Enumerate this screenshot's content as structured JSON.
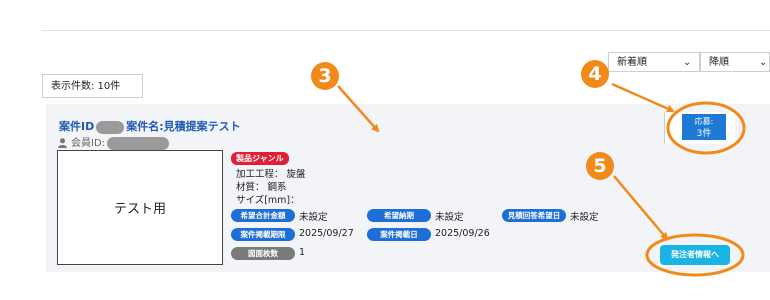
{
  "sort": {
    "newest_label": "新着順",
    "order_label": "降順"
  },
  "results": {
    "count_label": "表示件数: 10件"
  },
  "listing": {
    "id_label": "案件ID",
    "name_label": "案件名:見積提案テスト",
    "member_label": "会員ID:",
    "thumbnail_text": "テスト用",
    "genre_badge": "製品ジャンル",
    "specs": [
      "加工工程： 旋盤",
      "材質： 鋼系",
      "サイズ[mm]："
    ],
    "fields": {
      "budget_label": "希望合計金額",
      "budget_value": "未設定",
      "delivery_label": "希望納期",
      "delivery_value": "未設定",
      "quote_deadline_label": "見積回答希望日",
      "quote_deadline_value": "未設定",
      "posting_deadline_label": "案件掲載期限",
      "posting_deadline_value": "2025/09/27",
      "posted_date_label": "案件掲載日",
      "posted_date_value": "2025/09/26",
      "drawings_label": "図面枚数",
      "drawings_value": "1"
    },
    "apply_title": "応募:",
    "apply_count": "3件",
    "orderer_button": "発注者情報へ"
  },
  "callouts": [
    "3",
    "4",
    "5"
  ],
  "colors": {
    "callout": "#f28a1a",
    "primary_blue": "#1d6ed6",
    "genre_red": "#e01e35",
    "orderer_button": "#19b3e6"
  }
}
